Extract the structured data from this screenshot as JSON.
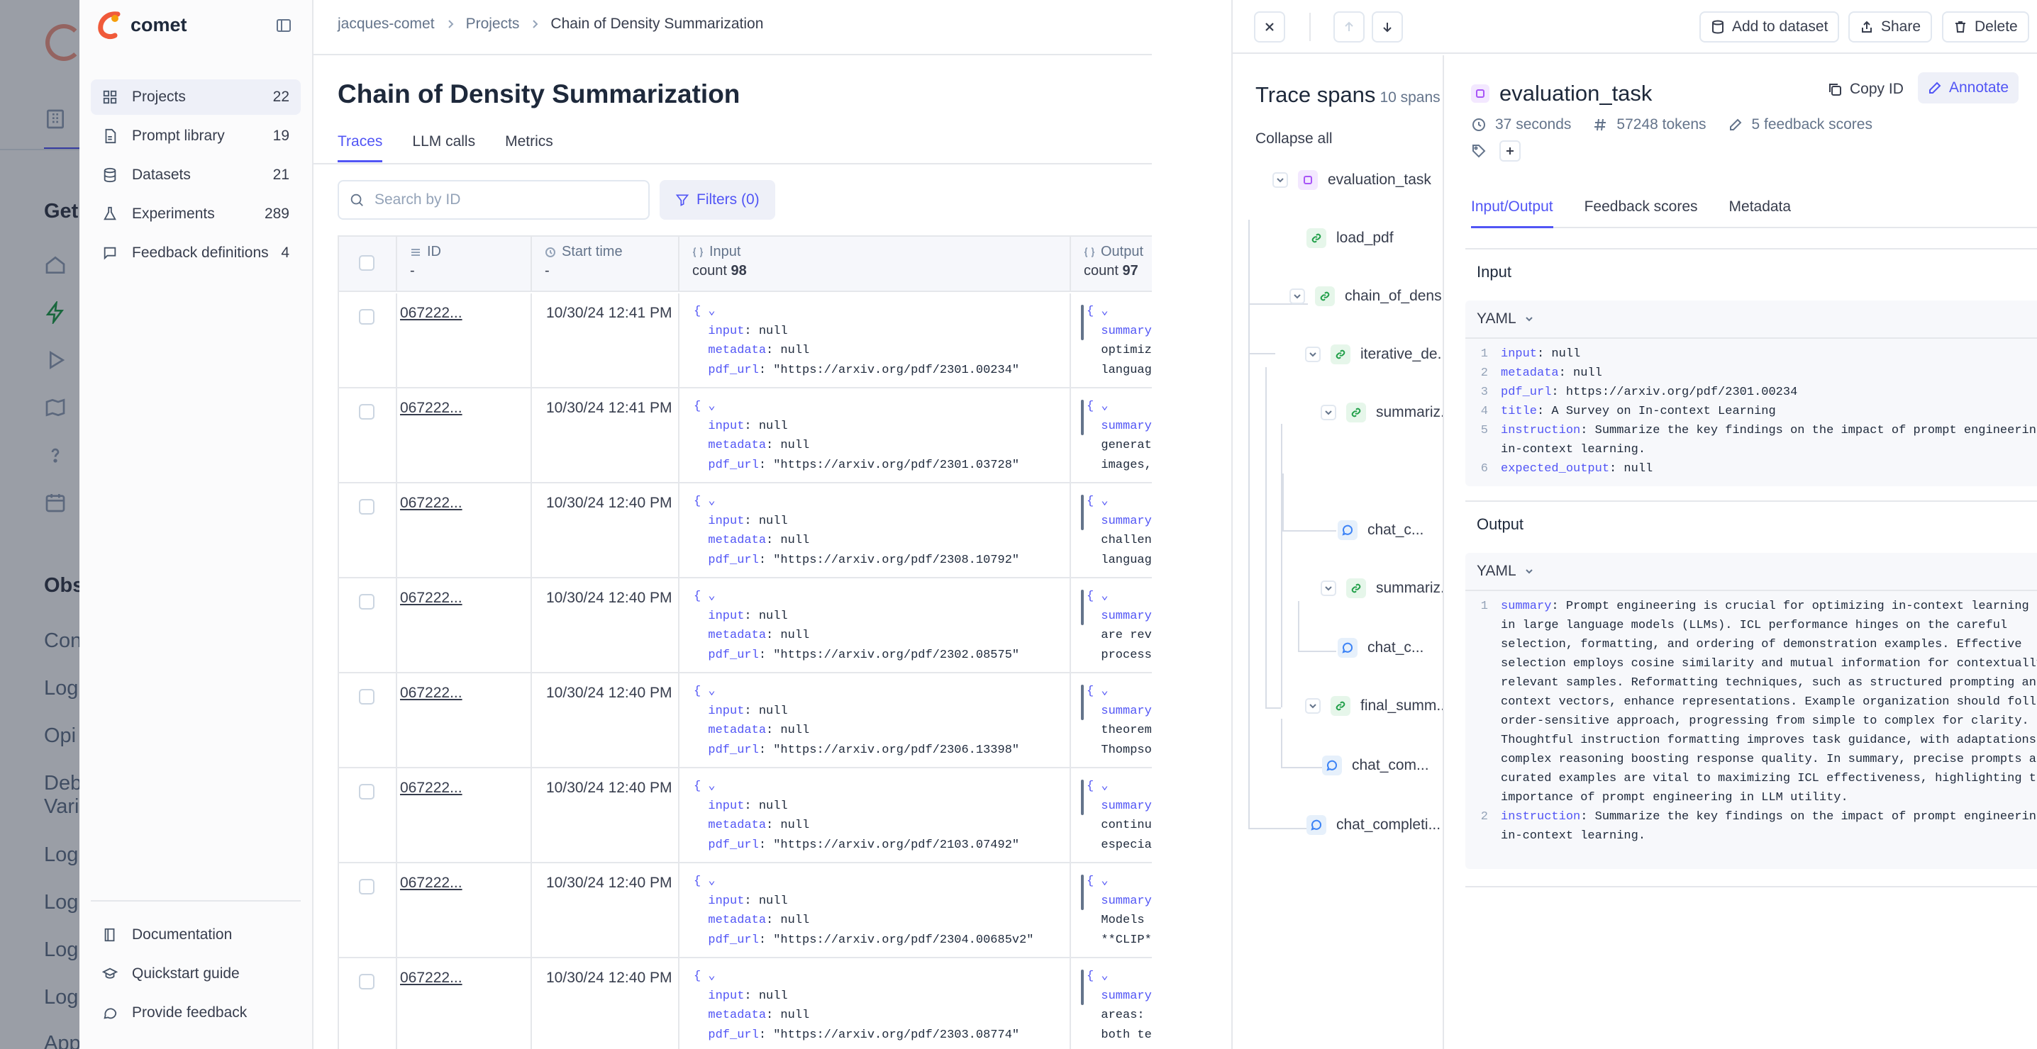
{
  "background_page": {
    "header_text": "Get",
    "section_text": "Obs",
    "items": [
      "Con",
      "Log",
      "Opi",
      "Deb",
      "Vari",
      "Log",
      "Log",
      "Log",
      "Log",
      "App"
    ]
  },
  "brand": {
    "name": "comet"
  },
  "sidebar": {
    "items": [
      {
        "label": "Projects",
        "count": "22",
        "icon": "grid-icon"
      },
      {
        "label": "Prompt library",
        "count": "19",
        "icon": "file-icon"
      },
      {
        "label": "Datasets",
        "count": "21",
        "icon": "database-icon"
      },
      {
        "label": "Experiments",
        "count": "289",
        "icon": "flask-icon"
      },
      {
        "label": "Feedback definitions",
        "count": "4",
        "icon": "message-icon"
      }
    ],
    "footer": [
      {
        "label": "Documentation",
        "icon": "book-icon"
      },
      {
        "label": "Quickstart guide",
        "icon": "graduation-cap-icon"
      },
      {
        "label": "Provide feedback",
        "icon": "message-circle-icon"
      }
    ]
  },
  "breadcrumb": [
    "jacques-comet",
    "Projects",
    "Chain of Density Summarization"
  ],
  "page": {
    "title": "Chain of Density Summarization",
    "tabs": [
      "Traces",
      "LLM calls",
      "Metrics"
    ],
    "search_placeholder": "Search by ID",
    "filters_label": "Filters (0)"
  },
  "table": {
    "columns": {
      "id": {
        "label": "ID",
        "sub": "-"
      },
      "start": {
        "label": "Start time",
        "sub": "-"
      },
      "input": {
        "label": "Input",
        "sub_prefix": "count",
        "sub_value": "98"
      },
      "output": {
        "label": "Output",
        "sub_prefix": "count",
        "sub_value": "97"
      }
    },
    "rows": [
      {
        "id": "067222...",
        "time": "10/30/24 12:41 PM",
        "pdf_url": "\"https://arxiv.org/pdf/2301.00234\"",
        "out1": "optimiz",
        "out2": "languag"
      },
      {
        "id": "067222...",
        "time": "10/30/24 12:41 PM",
        "pdf_url": "\"https://arxiv.org/pdf/2301.03728\"",
        "out1": "generat",
        "out2": "images,"
      },
      {
        "id": "067222...",
        "time": "10/30/24 12:40 PM",
        "pdf_url": "\"https://arxiv.org/pdf/2308.10792\"",
        "out1": "challen",
        "out2": "languag"
      },
      {
        "id": "067222...",
        "time": "10/30/24 12:40 PM",
        "pdf_url": "\"https://arxiv.org/pdf/2302.08575\"",
        "out1": "are rev",
        "out2": "process"
      },
      {
        "id": "067222...",
        "time": "10/30/24 12:40 PM",
        "pdf_url": "\"https://arxiv.org/pdf/2306.13398\"",
        "out1": "theorem",
        "out2": "Thompso"
      },
      {
        "id": "067222...",
        "time": "10/30/24 12:40 PM",
        "pdf_url": "\"https://arxiv.org/pdf/2103.07492\"",
        "out1": "continu",
        "out2": "especia"
      },
      {
        "id": "067222...",
        "time": "10/30/24 12:40 PM",
        "pdf_url": "\"https://arxiv.org/pdf/2304.00685v2\"",
        "out1": "Models ",
        "out2": "**CLIP*"
      },
      {
        "id": "067222...",
        "time": "10/30/24 12:40 PM",
        "pdf_url": "\"https://arxiv.org/pdf/2303.08774\"",
        "out1": "areas: ",
        "out2": "both te"
      }
    ]
  },
  "drawer": {
    "buttons": {
      "add_to_dataset": "Add to dataset",
      "share": "Share",
      "delete": "Delete"
    },
    "trace": {
      "title": "Trace spans",
      "count": "10 spans",
      "collapse_all": "Collapse all",
      "nodes": [
        {
          "label": "evaluation_task",
          "type": "trace"
        },
        {
          "label": "load_pdf",
          "type": "general"
        },
        {
          "label": "chain_of_dens...",
          "type": "general"
        },
        {
          "label": "iterative_de...",
          "type": "general"
        },
        {
          "label": "summariz...",
          "type": "general"
        },
        {
          "label": "chat_c...",
          "type": "llm"
        },
        {
          "label": "summariz...",
          "type": "general"
        },
        {
          "label": "chat_c...",
          "type": "llm"
        },
        {
          "label": "final_summ...",
          "type": "general"
        },
        {
          "label": "chat_com...",
          "type": "llm"
        },
        {
          "label": "chat_completi...",
          "type": "llm"
        }
      ]
    },
    "span": {
      "name": "evaluation_task",
      "copy_id": "Copy ID",
      "annotate": "Annotate",
      "duration": "37 seconds",
      "tokens": "57248 tokens",
      "feedback": "5 feedback scores",
      "tabs": [
        "Input/Output",
        "Feedback scores",
        "Metadata"
      ],
      "input_section": "Input",
      "output_section": "Output",
      "format": "YAML",
      "input_lines": [
        {
          "num": "1",
          "key": "input",
          "value": ": null"
        },
        {
          "num": "2",
          "key": "metadata",
          "value": ": null"
        },
        {
          "num": "3",
          "key": "pdf_url",
          "value": ": https://arxiv.org/pdf/2301.00234"
        },
        {
          "num": "4",
          "key": "title",
          "value": ": A Survey on In-context Learning"
        },
        {
          "num": "5",
          "key": "instruction",
          "value": ": Summarize the key findings on the impact of prompt engineering in in-context learning."
        },
        {
          "num": "6",
          "key": "expected_output",
          "value": ": null"
        }
      ],
      "output_lines": [
        {
          "num": "1",
          "key": "summary",
          "value": ": Prompt engineering is crucial for optimizing in-context learning (ICL) in large language models (LLMs). ICL performance hinges on the careful selection, formatting, and ordering of demonstration examples. Effective selection employs cosine similarity and mutual information for contextually relevant samples. Reformatting techniques, such as structured prompting and in-context vectors, enhance representations. Example organization should follow an order-sensitive approach, progressing from simple to complex for clarity. Thoughtful instruction formatting improves task guidance, with adaptations for complex reasoning boosting response quality. In summary, precise prompts and curated examples are vital to maximizing ICL effectiveness, highlighting the importance of prompt engineering in LLM utility."
        },
        {
          "num": "2",
          "key": "instruction",
          "value": ": Summarize the key findings on the impact of prompt engineering in in-context learning."
        }
      ]
    }
  },
  "colors": {
    "accent": "#5155f5",
    "overlay": "#0f172a",
    "brand": "#f05a3a"
  }
}
